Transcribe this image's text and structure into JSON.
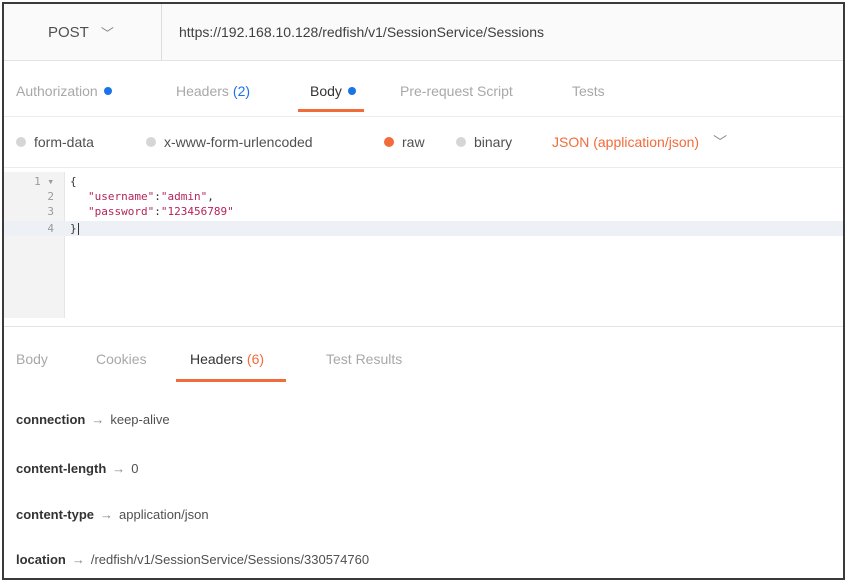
{
  "request": {
    "method": "POST",
    "url": "https://192.168.10.128/redfish/v1/SessionService/Sessions"
  },
  "request_tabs": [
    {
      "label": "Authorization",
      "dot": true
    },
    {
      "label": "Headers",
      "count": "(2)"
    },
    {
      "label": "Body",
      "dot": true,
      "active": true
    },
    {
      "label": "Pre-request Script"
    },
    {
      "label": "Tests"
    }
  ],
  "body_types": {
    "form_data": "form-data",
    "urlencoded": "x-www-form-urlencoded",
    "raw": "raw",
    "binary": "binary",
    "selected": "raw",
    "format": "JSON (application/json)"
  },
  "editor": {
    "lines": [
      {
        "num": "1",
        "fold": "▾",
        "text": "{"
      },
      {
        "num": "2",
        "key": "\"username\"",
        "value": "\"admin\"",
        "trail": ","
      },
      {
        "num": "3",
        "key": "\"password\"",
        "value": "\"123456789\"",
        "trail": ""
      },
      {
        "num": "4",
        "text": "}"
      }
    ]
  },
  "response_tabs": [
    {
      "label": "Body"
    },
    {
      "label": "Cookies"
    },
    {
      "label": "Headers",
      "count": "(6)",
      "active": true
    },
    {
      "label": "Test Results"
    }
  ],
  "response_headers": [
    {
      "name": "connection",
      "value": "keep-alive"
    },
    {
      "name": "content-length",
      "value": "0"
    },
    {
      "name": "content-type",
      "value": "application/json"
    },
    {
      "name": "location",
      "value": "/redfish/v1/SessionService/Sessions/330574760"
    }
  ],
  "arrow": "→",
  "colors": {
    "accent": "#f26b3a",
    "dot": "#1a73e8"
  }
}
